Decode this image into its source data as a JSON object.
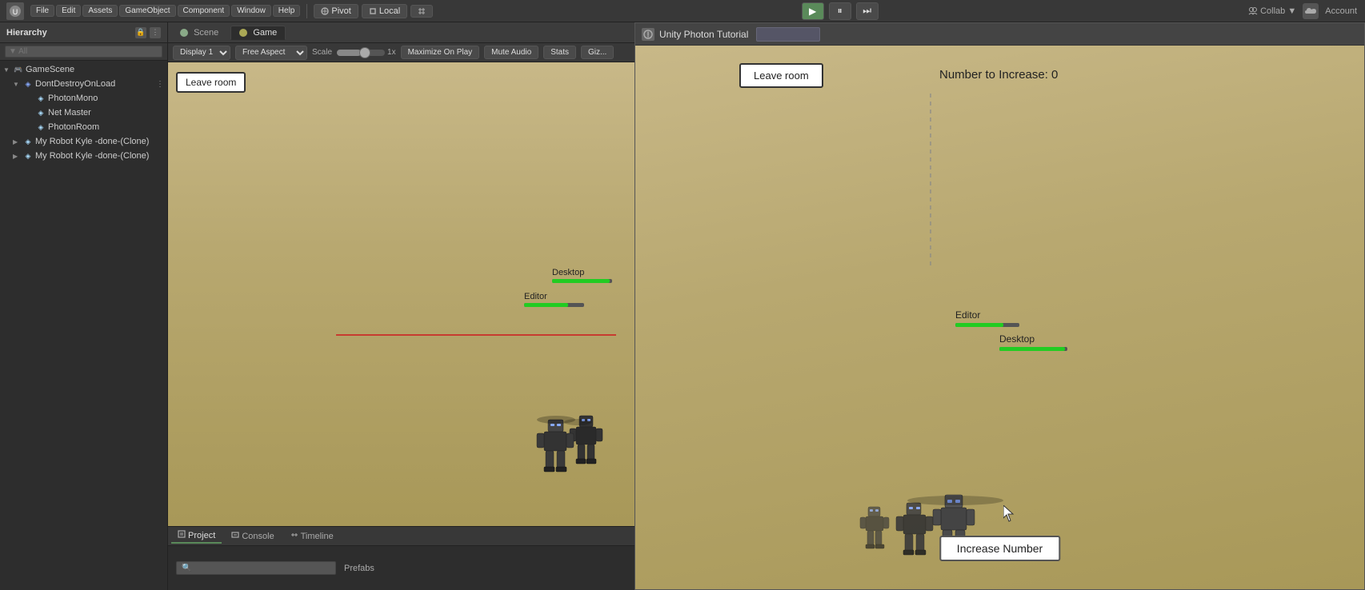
{
  "topbar": {
    "unity_icon": "U",
    "pivot_label": "Pivot",
    "local_label": "Local",
    "collab_label": "Collab ▼",
    "account_label": "Account",
    "cloud_icon": "☁"
  },
  "hierarchy": {
    "title": "Hierarchy",
    "search_placeholder": "▼ All",
    "items": [
      {
        "label": "GameScene",
        "level": 0,
        "has_arrow": true,
        "icon": "🎮"
      },
      {
        "label": "DontDestroyOnLoad",
        "level": 1,
        "has_arrow": true,
        "icon": "🔧"
      },
      {
        "label": "PhotonMono",
        "level": 2,
        "icon": "📷"
      },
      {
        "label": "Net Master",
        "level": 2,
        "icon": "📷"
      },
      {
        "label": "PhotonRoom",
        "level": 2,
        "icon": "📷"
      },
      {
        "label": "My Robot Kyle -done-(Clone)",
        "level": 1,
        "has_arrow": true,
        "icon": "🤖"
      },
      {
        "label": "My Robot Kyle -done-(Clone)",
        "level": 1,
        "has_arrow": true,
        "icon": "🤖"
      }
    ]
  },
  "editor": {
    "tabs": [
      "Scene",
      "Game"
    ],
    "active_tab": "Game",
    "toolbar": {
      "display_label": "Display 1",
      "aspect_label": "Free Aspect",
      "scale_label": "Scale",
      "scale_icon": "●",
      "scale_value": "1x",
      "maximize_label": "Maximize On Play",
      "mute_label": "Mute Audio",
      "stats_label": "Stats",
      "gizmos_label": "Giz..."
    }
  },
  "game_view": {
    "leave_room_label": "Leave room",
    "number_display": "Number to Increase: 0",
    "increase_btn_label": "Increase Number",
    "player1_label": "Desktop",
    "player2_label": "Editor"
  },
  "photon_window": {
    "title": "Unity Photon Tutorial",
    "btn1_label": "",
    "leave_room_label": "Leave room",
    "number_display": "Number to Increase: 0",
    "increase_btn_label": "Increase Number",
    "player1_label": "Desktop",
    "player2_label": "Editor"
  },
  "bottom_panel": {
    "tabs": [
      "Project",
      "Console",
      "Timeline"
    ],
    "active_tab": "Project",
    "folder_label": "Prefabs"
  }
}
